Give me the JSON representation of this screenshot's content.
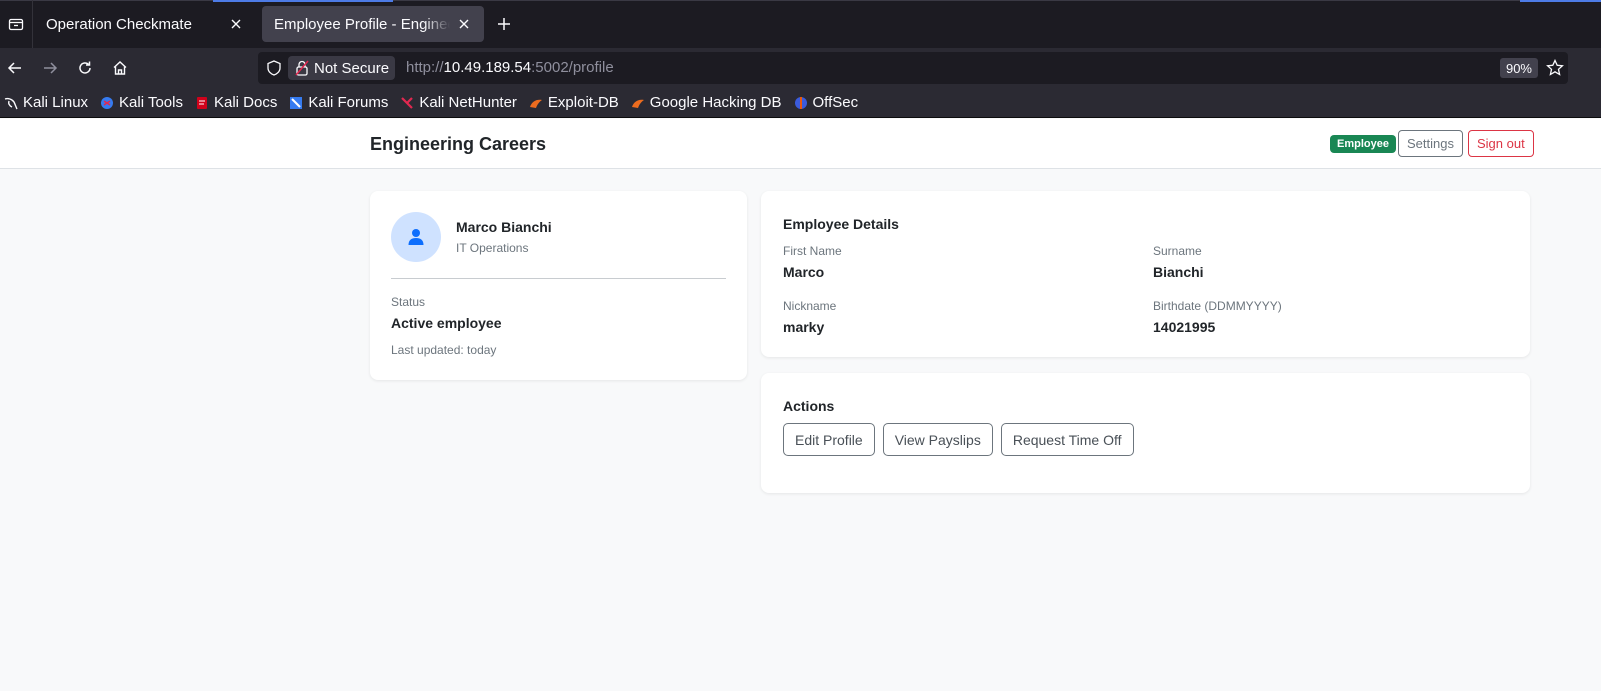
{
  "browser": {
    "tabs": [
      {
        "title": "Operation Checkmate"
      },
      {
        "title": "Employee Profile - Engineering Careers"
      }
    ],
    "url": {
      "security_label": "Not Secure",
      "scheme": "http://",
      "host": "10.49.189.54",
      "rest": ":5002/profile"
    },
    "zoom": "90%",
    "bookmarks": [
      {
        "label": "Kali Linux",
        "icon": "kali-dragon-icon"
      },
      {
        "label": "Kali Tools",
        "icon": "kali-tools-icon"
      },
      {
        "label": "Kali Docs",
        "icon": "kali-docs-icon"
      },
      {
        "label": "Kali Forums",
        "icon": "kali-forums-icon"
      },
      {
        "label": "Kali NetHunter",
        "icon": "kali-nethunter-icon"
      },
      {
        "label": "Exploit-DB",
        "icon": "exploit-db-icon"
      },
      {
        "label": "Google Hacking DB",
        "icon": "ghdb-icon"
      },
      {
        "label": "OffSec",
        "icon": "offsec-icon"
      }
    ]
  },
  "header": {
    "brand": "Engineering Careers",
    "role_badge": "Employee",
    "settings_label": "Settings",
    "signout_label": "Sign out"
  },
  "profile": {
    "name": "Marco Bianchi",
    "department": "IT Operations",
    "status_label": "Status",
    "status_value": "Active employee",
    "last_updated": "Last updated: today"
  },
  "details": {
    "title": "Employee Details",
    "first_name_label": "First Name",
    "first_name": "Marco",
    "surname_label": "Surname",
    "surname": "Bianchi",
    "nickname_label": "Nickname",
    "nickname": "marky",
    "birthdate_label": "Birthdate (DDMMYYYY)",
    "birthdate": "14021995"
  },
  "actions": {
    "title": "Actions",
    "buttons": [
      "Edit Profile",
      "View Payslips",
      "Request Time Off"
    ]
  },
  "colors": {
    "badge_green": "#198754",
    "danger": "#dc3545",
    "avatar_bg": "#cfe2ff",
    "avatar_icon": "#0d6efd"
  }
}
